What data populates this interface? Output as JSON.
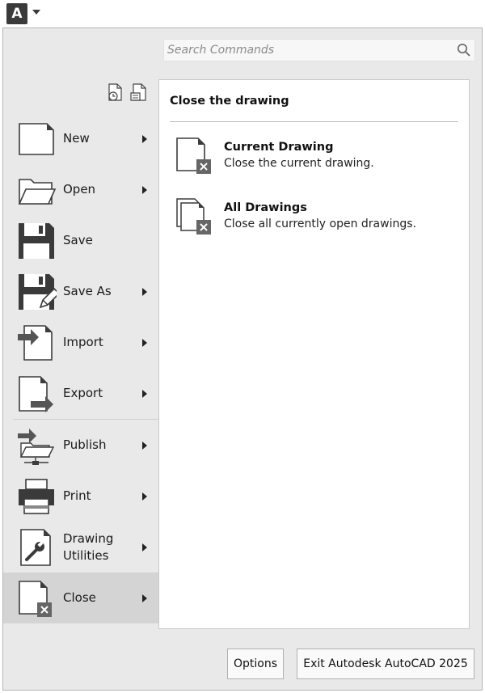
{
  "app_button": {
    "letter": "A"
  },
  "search": {
    "placeholder": "Search Commands",
    "value": ""
  },
  "left_menu": {
    "items": [
      {
        "label": "New",
        "icon": "new-drawing-icon",
        "submenu": true
      },
      {
        "label": "Open",
        "icon": "open-folder-icon",
        "submenu": true
      },
      {
        "label": "Save",
        "icon": "floppy-disk-icon",
        "submenu": false
      },
      {
        "label": "Save As",
        "icon": "save-as-icon",
        "submenu": true
      },
      {
        "label": "Import",
        "icon": "import-icon",
        "submenu": true
      },
      {
        "label": "Export",
        "icon": "export-icon",
        "submenu": true
      },
      {
        "label": "Publish",
        "icon": "publish-icon",
        "submenu": true
      },
      {
        "label": "Print",
        "icon": "printer-icon",
        "submenu": true
      },
      {
        "label_line1": "Drawing",
        "label_line2": "Utilities",
        "icon": "drawing-utilities-icon",
        "submenu": true
      },
      {
        "label": "Close",
        "icon": "close-drawing-icon",
        "submenu": true,
        "active": true
      }
    ]
  },
  "top_icons": [
    "recent-documents-icon",
    "open-documents-icon"
  ],
  "panel": {
    "title": "Close the drawing",
    "items": [
      {
        "title": "Current Drawing",
        "desc": "Close the current drawing.",
        "icon": "close-current-drawing-icon"
      },
      {
        "title": "All Drawings",
        "desc": "Close all currently open drawings.",
        "icon": "close-all-drawings-icon"
      }
    ]
  },
  "footer": {
    "options_label": "Options",
    "exit_label": "Exit Autodesk AutoCAD 2025"
  },
  "colors": {
    "frame_bg": "#e9e9e9",
    "active_item_bg": "#d4d4d4",
    "icon_dark": "#3c3c3c",
    "panel_bg": "#ffffff"
  }
}
